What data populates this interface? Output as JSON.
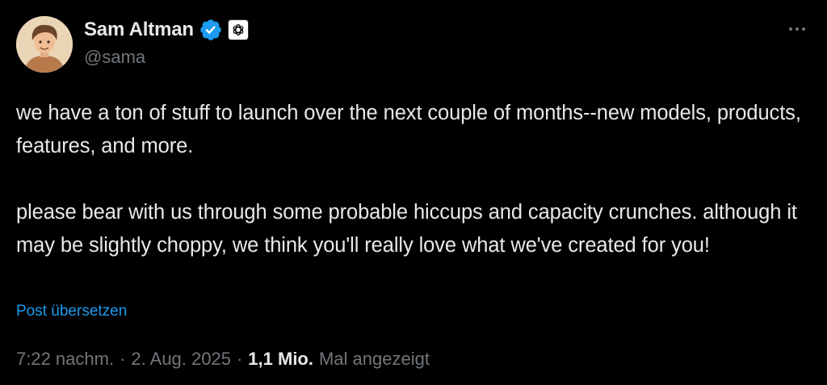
{
  "author": {
    "display_name": "Sam Altman",
    "handle": "@sama",
    "verified_icon": "verified-badge-icon",
    "affiliate_icon": "openai-logo-icon",
    "accent_color": "#1d9bf0"
  },
  "tweet": {
    "paragraphs": [
      "we have a ton of stuff to launch over the next couple of months--new models, products, features, and more.",
      "please bear with us through some probable hiccups and capacity crunches. although it may be slightly choppy, we think you'll really love what we've created for you!"
    ],
    "translate_label": "Post übersetzen"
  },
  "meta": {
    "time": "7:22 nachm.",
    "separator": "·",
    "date": "2. Aug. 2025",
    "views_count": "1,1 Mio.",
    "views_label": "Mal angezeigt"
  },
  "actions": {
    "more_icon": "more-horizontal-icon"
  },
  "colors": {
    "background": "#000000",
    "primary_text": "#e7e9ea",
    "secondary_text": "#71767b",
    "link": "#1d9bf0"
  }
}
